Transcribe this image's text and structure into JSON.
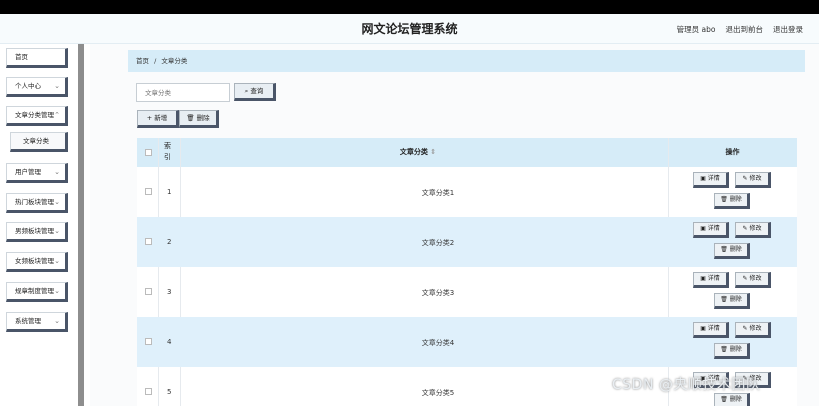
{
  "header": {
    "title": "网文论坛管理系统",
    "user_label": "管理员 abo",
    "front_link": "退出到前台",
    "logout_link": "退出登录"
  },
  "sidebar": {
    "items": [
      {
        "label": "首页",
        "chevron": ""
      },
      {
        "label": "个人中心",
        "chevron": "⌄"
      },
      {
        "label": "文章分类管理",
        "chevron": "⌃"
      },
      {
        "label": "文章分类",
        "chevron": ""
      },
      {
        "label": "用户管理",
        "chevron": "⌄"
      },
      {
        "label": "热门板块管理",
        "chevron": "⌄"
      },
      {
        "label": "男频板块管理",
        "chevron": "⌄"
      },
      {
        "label": "女频板块管理",
        "chevron": "⌄"
      },
      {
        "label": "规章制度管理",
        "chevron": "⌄"
      },
      {
        "label": "系统管理",
        "chevron": "⌄"
      }
    ]
  },
  "breadcrumb": {
    "home": "首页",
    "separator": "/",
    "current": "文章分类"
  },
  "search": {
    "placeholder": "文章分类",
    "button_label": "查询",
    "button_icon": "search-icon"
  },
  "actions": {
    "add_label": "新增",
    "delete_label": "删除"
  },
  "table": {
    "columns": {
      "index": "索引",
      "name": "文章分类",
      "sort_mark": "⇕",
      "operation": "操作"
    },
    "row_buttons": {
      "detail": "详情",
      "edit": "修改",
      "delete": "删除"
    },
    "rows": [
      {
        "index": "1",
        "name": "文章分类1"
      },
      {
        "index": "2",
        "name": "文章分类2"
      },
      {
        "index": "3",
        "name": "文章分类3"
      },
      {
        "index": "4",
        "name": "文章分类4"
      },
      {
        "index": "5",
        "name": "文章分类5"
      }
    ]
  },
  "watermark": "CSDN @央顺技术团队"
}
